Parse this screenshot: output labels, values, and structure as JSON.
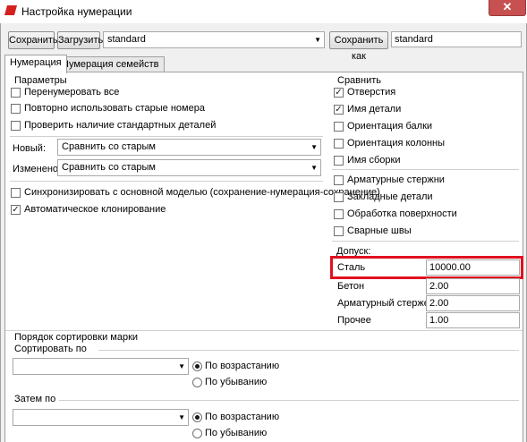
{
  "window": {
    "title": "Настройка нумерации",
    "close_glyph": "✕"
  },
  "toolbar": {
    "save_label": "Сохранить",
    "load_label": "Загрузить",
    "preset_value": "standard",
    "save_as_label": "Сохранить как",
    "save_as_value": "standard"
  },
  "tabs": [
    {
      "label": "Нумерация",
      "active": true
    },
    {
      "label": "Нумерация семейств",
      "active": false
    }
  ],
  "params": {
    "heading": "Параметры",
    "checks": [
      {
        "label": "Перенумеровать все",
        "checked": false
      },
      {
        "label": "Повторно использовать старые номера",
        "checked": false
      },
      {
        "label": "Проверить наличие стандартных деталей",
        "checked": false
      }
    ],
    "new_label": "Новый:",
    "new_value": "Сравнить со старым",
    "changed_label": "Изменено:",
    "changed_value": "Сравнить со старым",
    "sync_label": "Синхронизировать с основной моделью (сохранение-нумерация-сохранение)",
    "sync_checked": false,
    "clone_label": "Автоматическое клонирование",
    "clone_checked": true
  },
  "compare": {
    "heading": "Сравнить",
    "group1": [
      {
        "label": "Отверстия",
        "checked": true
      },
      {
        "label": "Имя детали",
        "checked": true
      },
      {
        "label": "Ориентация балки",
        "checked": false
      },
      {
        "label": "Ориентация колонны",
        "checked": false
      },
      {
        "label": "Имя сборки",
        "checked": false
      }
    ],
    "group2": [
      {
        "label": "Арматурные стержни",
        "checked": false
      },
      {
        "label": "Закладные детали",
        "checked": false
      },
      {
        "label": "Обработка поверхности",
        "checked": false
      },
      {
        "label": "Сварные швы",
        "checked": false
      }
    ],
    "tolerance_heading": "Допуск:",
    "tolerances": [
      {
        "label": "Сталь",
        "value": "10000.00",
        "highlighted": true
      },
      {
        "label": "Бетон",
        "value": "2.00",
        "highlighted": false
      },
      {
        "label": "Арматурный стержень",
        "value": "2.00",
        "highlighted": false
      },
      {
        "label": "Прочее",
        "value": "1.00",
        "highlighted": false
      }
    ]
  },
  "sort": {
    "heading": "Порядок сортировки марки",
    "sort_by_label": "Сортировать по",
    "then_by_label": "Затем по",
    "ascending_label": "По возрастанию",
    "descending_label": "По убыванию"
  },
  "colors": {
    "highlight": "#e01020",
    "close_button": "#c75050",
    "app_icon": "#d42020"
  }
}
